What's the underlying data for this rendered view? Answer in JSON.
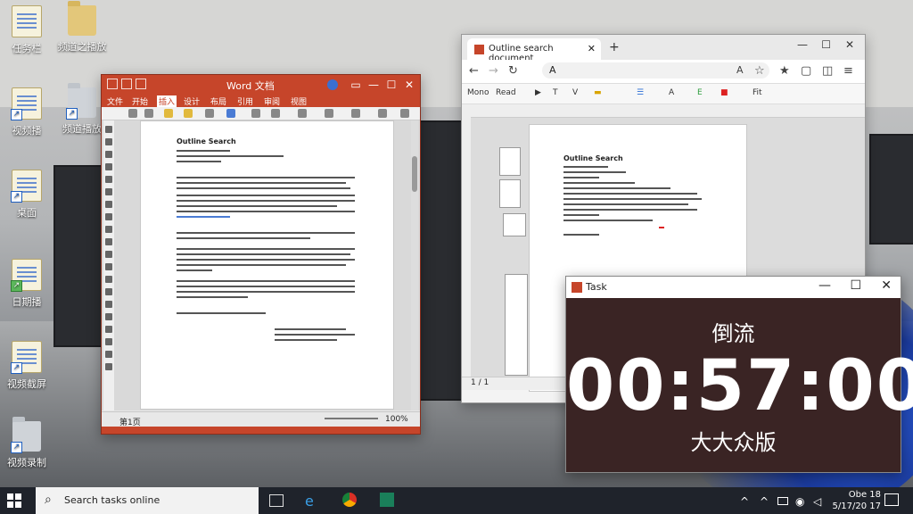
{
  "desktop": {
    "icons": [
      {
        "label": "任务栏",
        "icon": "document-icon"
      },
      {
        "label": "频道之播放",
        "icon": "folder-icon"
      },
      {
        "label": "视频播",
        "icon": "document-shortcut-icon"
      },
      {
        "label": "频道播放",
        "icon": "folder-shortcut-icon"
      },
      {
        "label": "桌面",
        "icon": "document-shortcut-icon"
      },
      {
        "label": "日期播",
        "icon": "document-shortcut-icon"
      },
      {
        "label": "视频截屏",
        "icon": "document-shortcut-icon"
      },
      {
        "label": "视频录制",
        "icon": "folder-shortcut-icon"
      }
    ]
  },
  "word": {
    "title": "Word 文档",
    "tabs": [
      "文件",
      "开始",
      "插入",
      "设计",
      "布局",
      "引用",
      "审阅",
      "视图"
    ],
    "doc_heading": "Outline Search",
    "status_left": "第1页",
    "zoom": "100%"
  },
  "browser": {
    "tab_title": "Outline search document",
    "new_tab": "+",
    "address_text": "A",
    "pdf_toolbar": [
      "Mono",
      "Read",
      "T",
      "V",
      "A",
      "E",
      "Fit"
    ],
    "doc_heading": "Outline Search",
    "page_indicator": "1 / 1",
    "window_controls": [
      "—",
      "☐",
      "✕"
    ]
  },
  "timer": {
    "title": "Task",
    "mode_label": "倒流",
    "time": "00:57:00",
    "subtitle": "大大众版",
    "window_controls": [
      "—",
      "☐",
      "✕"
    ]
  },
  "taskbar": {
    "search_placeholder": "Search tasks online",
    "time": "Obe 18",
    "date": "5/17/20 17",
    "pinned": [
      "file-explorer-icon",
      "edge-icon",
      "chrome-icon",
      "store-icon"
    ]
  }
}
